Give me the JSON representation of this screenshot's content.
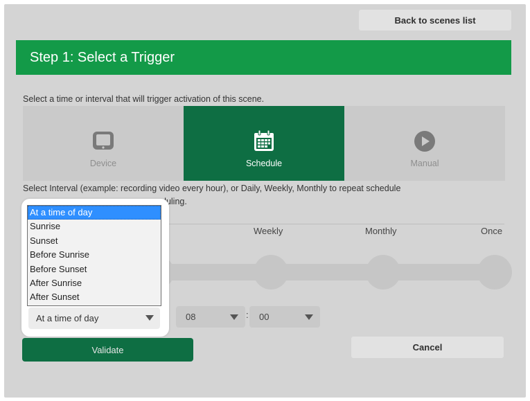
{
  "header": {
    "back_label": "Back to scenes list",
    "step_title": "Step 1: Select a Trigger"
  },
  "intro_text": "Select a time or interval that will trigger activation of this scene.",
  "trigger_tabs": [
    {
      "label": "Device",
      "icon": "tablet-icon",
      "active": false
    },
    {
      "label": "Schedule",
      "icon": "calendar-icon",
      "active": true
    },
    {
      "label": "Manual",
      "icon": "play-icon",
      "active": false
    }
  ],
  "interval_text_line1": "Select Interval (example: recording video every hour), or Daily, Weekly, Monthly to repeat schedule",
  "interval_text_line2_visible": "duling.",
  "frequency": {
    "weekly": "Weekly",
    "monthly": "Monthly",
    "once": "Once"
  },
  "time": {
    "hour": "08",
    "minute": "00",
    "separator": ":"
  },
  "time_mode": {
    "selected": "At a time of day",
    "options": [
      "At a time of day",
      "Sunrise",
      "Sunset",
      "Before Sunrise",
      "Before Sunset",
      "After Sunrise",
      "After Sunset"
    ]
  },
  "actions": {
    "validate_label": "Validate",
    "cancel_label": "Cancel"
  },
  "colors": {
    "accent_green": "#139a48",
    "dark_green": "#0e6e43",
    "panel_gray": "#d4d4d4",
    "selection_blue": "#2f8fff"
  }
}
